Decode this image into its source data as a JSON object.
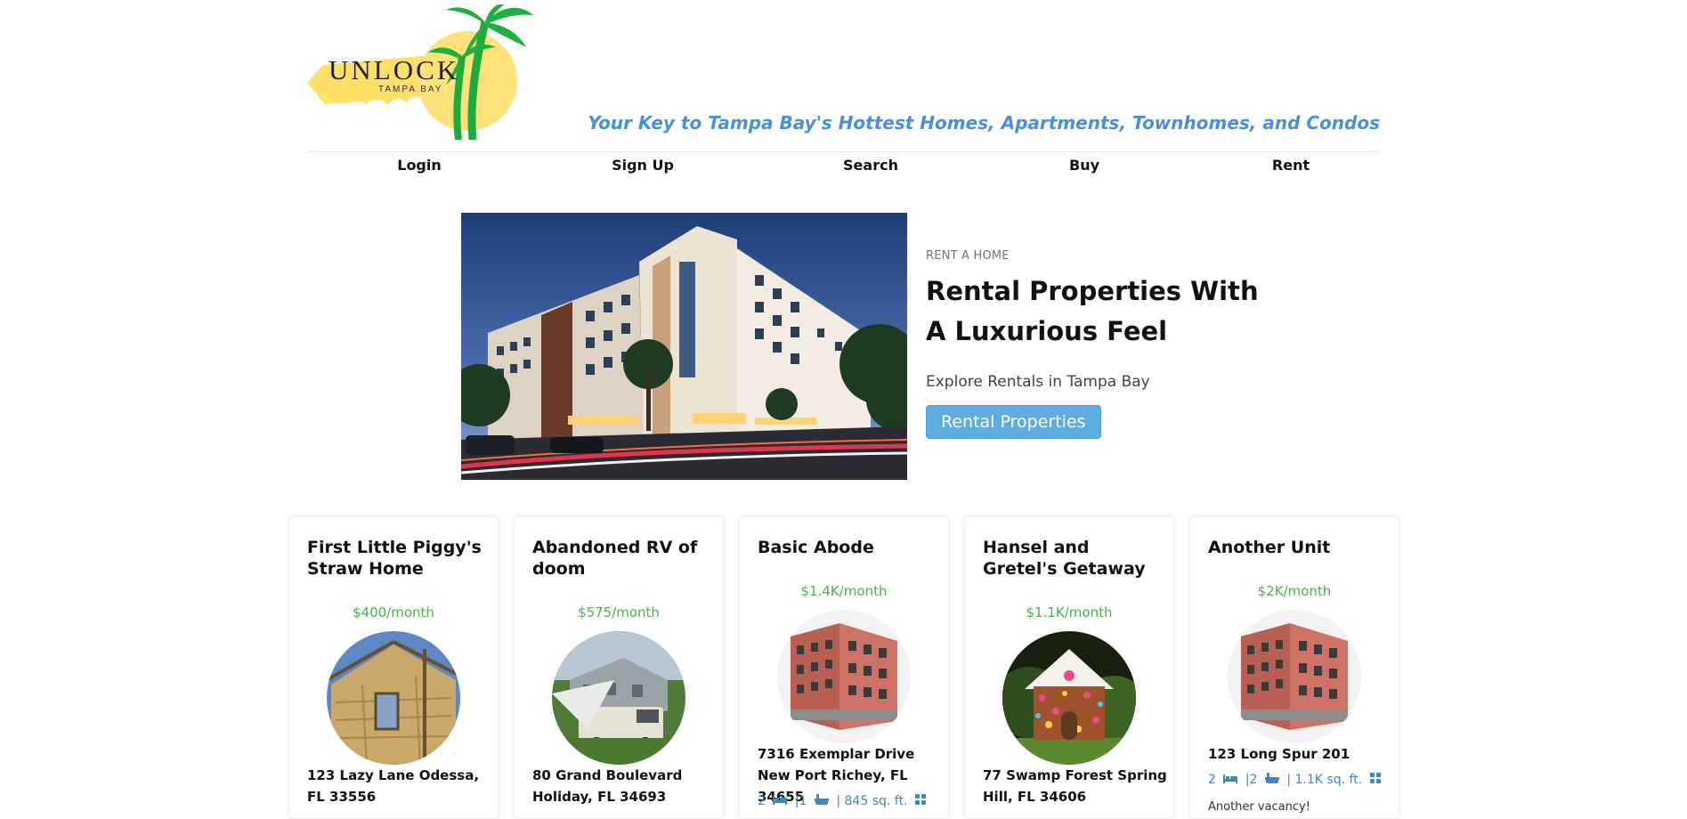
{
  "brand": {
    "logo_word": "UNLOCK",
    "logo_sub": "TAMPA BAY",
    "tagline": "Your Key to Tampa Bay's Hottest Homes, Apartments, Townhomes, and Condos"
  },
  "nav": {
    "items": [
      "Login",
      "Sign Up",
      "Search",
      "Buy",
      "Rent"
    ]
  },
  "hero": {
    "eyebrow": "RENT A HOME",
    "title_line1": "Rental Properties With",
    "title_line2": "A Luxurious Feel",
    "subtitle": "Explore Rentals in Tampa Bay",
    "button": "Rental Properties"
  },
  "colors": {
    "tagline": "#4a90d9",
    "price": "#4caf50",
    "button": "#5dade2",
    "stat_icon": "#3f86c9"
  },
  "listings": [
    {
      "title": "First Little Piggy's Straw Home",
      "price": "$400/month",
      "address": "123 Lazy Lane Odessa, FL 33556",
      "photo": "straw-house"
    },
    {
      "title": "Abandoned RV of doom",
      "price": "$575/month",
      "address": "80 Grand Boulevard Holiday, FL 34693",
      "photo": "abandoned-rv"
    },
    {
      "title": "Basic Abode",
      "price": "$1.4K/month",
      "address": "7316 Exemplar Drive New Port Richey, FL 34655",
      "photo": "apartment-building",
      "beds": "2",
      "baths": "|1",
      "sqft": "| 845 sq. ft."
    },
    {
      "title": "Hansel and Gretel's Getaway",
      "price": "$1.1K/month",
      "address": "77 Swamp Forest Spring Hill, FL 34606",
      "photo": "gingerbread-house"
    },
    {
      "title": "Another Unit",
      "price": "$2K/month",
      "address": "123 Long Spur 201",
      "photo": "apartment-building",
      "beds": "2",
      "baths": "|2",
      "sqft": "| 1.1K sq. ft.",
      "note": "Another vacancy!"
    }
  ]
}
